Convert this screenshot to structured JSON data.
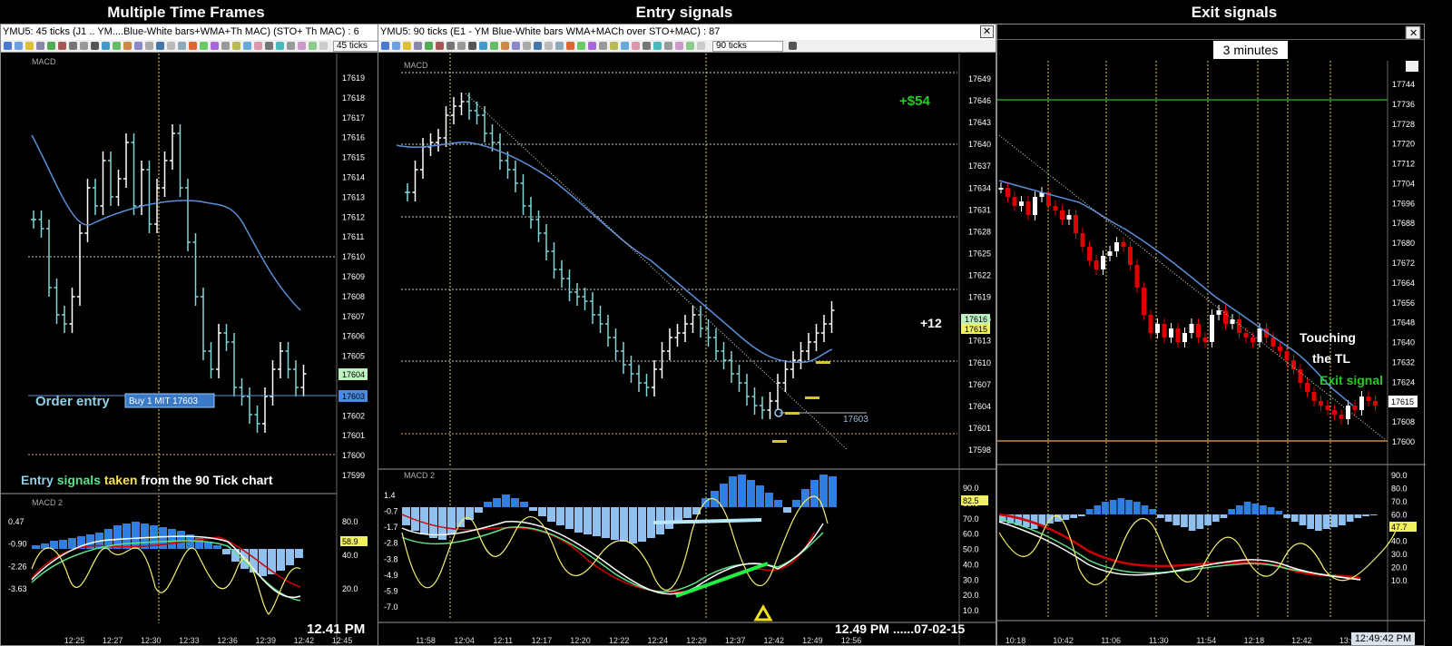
{
  "sections": {
    "left_title": "Multiple Time Frames",
    "middle_title": "Entry signals",
    "right_title": "Exit signals"
  },
  "colors": {
    "up_bar": "#7fd6d6",
    "down_bar": "#ffffff",
    "wma": "#5b8fd8",
    "macd_hist_up": "#2f7fe0",
    "macd_hist_down": "#8fc0f0",
    "stoch_yellow": "#f5f06e",
    "macd_white": "#ffffff",
    "macd_green": "#5fe08a",
    "macd_red": "#d00000",
    "red_candle": "#e00000",
    "profit_green": "#22cc22"
  },
  "left": {
    "titlebar": "YMU5: 45 ticks (J1 .. YM....Blue-White bars+WMA+Th MAC) (STO+ Th MAC) : 6",
    "tick_select": "45 ticks",
    "macd_label": "MACD",
    "macd2_label": "MACD 2",
    "price_ticks": [
      "17619",
      "17618",
      "17617",
      "17616",
      "17615",
      "17614",
      "17613",
      "17612",
      "17611",
      "17610",
      "17609",
      "17608",
      "17607",
      "17606",
      "17605",
      "17604",
      "17603",
      "17602",
      "17601",
      "17600",
      "17599"
    ],
    "current_price_tag": "17604",
    "order_price_tag": "17603",
    "order_entry_label": "Order entry",
    "order_box": "Buy 1 MIT 17603",
    "caption_parts": [
      "Entry ",
      "signals ",
      "taken ",
      "from the 90 Tick chart"
    ],
    "macd_levels": [
      "0.47",
      "-0.90",
      "-2.26",
      "-3.63"
    ],
    "stoch_levels": [
      "80.0",
      "40.0",
      "20.0"
    ],
    "stoch_tag": "58.9",
    "time_labels": [
      "12:25",
      "12:27",
      "12:30",
      "12:33",
      "12:36",
      "12:39",
      "12:42",
      "12:45"
    ],
    "stamp": "12.41 PM"
  },
  "middle": {
    "titlebar": "YMU5: 90 ticks (E1 - YM   Blue-White bars    WMA+MACh  over STO+MAC) : 87",
    "tick_select": "90 ticks",
    "macd_label": "MACD",
    "macd2_label": "MACD 2",
    "price_ticks": [
      "17649",
      "17646",
      "17643",
      "17640",
      "17637",
      "17634",
      "17631",
      "17628",
      "17625",
      "17622",
      "17619",
      "17616",
      "17613",
      "17610",
      "17607",
      "17604",
      "17601",
      "17598"
    ],
    "price_tag_green": "17616",
    "price_tag_yellow": "17615",
    "profit_label": "+$54",
    "points_label": "+12",
    "order_line_label": "17603",
    "macd_levels": [
      "1.4",
      "-0.7",
      "-1.7",
      "-2.8",
      "-3.8",
      "-4.9",
      "-5.9",
      "-7.0"
    ],
    "stoch_levels": [
      "90.0",
      "80.0",
      "70.0",
      "60.0",
      "50.0",
      "40.0",
      "30.0",
      "20.0",
      "10.0"
    ],
    "stoch_tag": "82.5",
    "time_labels": [
      "11:58",
      "12:04",
      "12:11",
      "12:17",
      "12:20",
      "12:22",
      "12:24",
      "12:29",
      "12:37",
      "12:42",
      "12:49",
      "12:56"
    ],
    "stamp": "12.49 PM   ......07-02-15"
  },
  "right": {
    "timeframe": "3 minutes",
    "price_ticks": [
      "17744",
      "17736",
      "17728",
      "17720",
      "17712",
      "17704",
      "17696",
      "17688",
      "17680",
      "17672",
      "17664",
      "17656",
      "17648",
      "17640",
      "17632",
      "17624",
      "17616",
      "17608",
      "17600"
    ],
    "price_tag": "17615",
    "touch_label_1": "Touching",
    "touch_label_2": "the TL",
    "exit_label": "Exit signal",
    "stoch_levels": [
      "90.0",
      "80.0",
      "70.0",
      "60.0",
      "50.0",
      "40.0",
      "30.0",
      "20.0",
      "10.0"
    ],
    "stoch_tag": "47.7",
    "time_labels": [
      "10:18",
      "10:42",
      "11:06",
      "11:30",
      "11:54",
      "12:18",
      "12:42",
      "13:06"
    ],
    "clock": "12:49:42 PM"
  }
}
